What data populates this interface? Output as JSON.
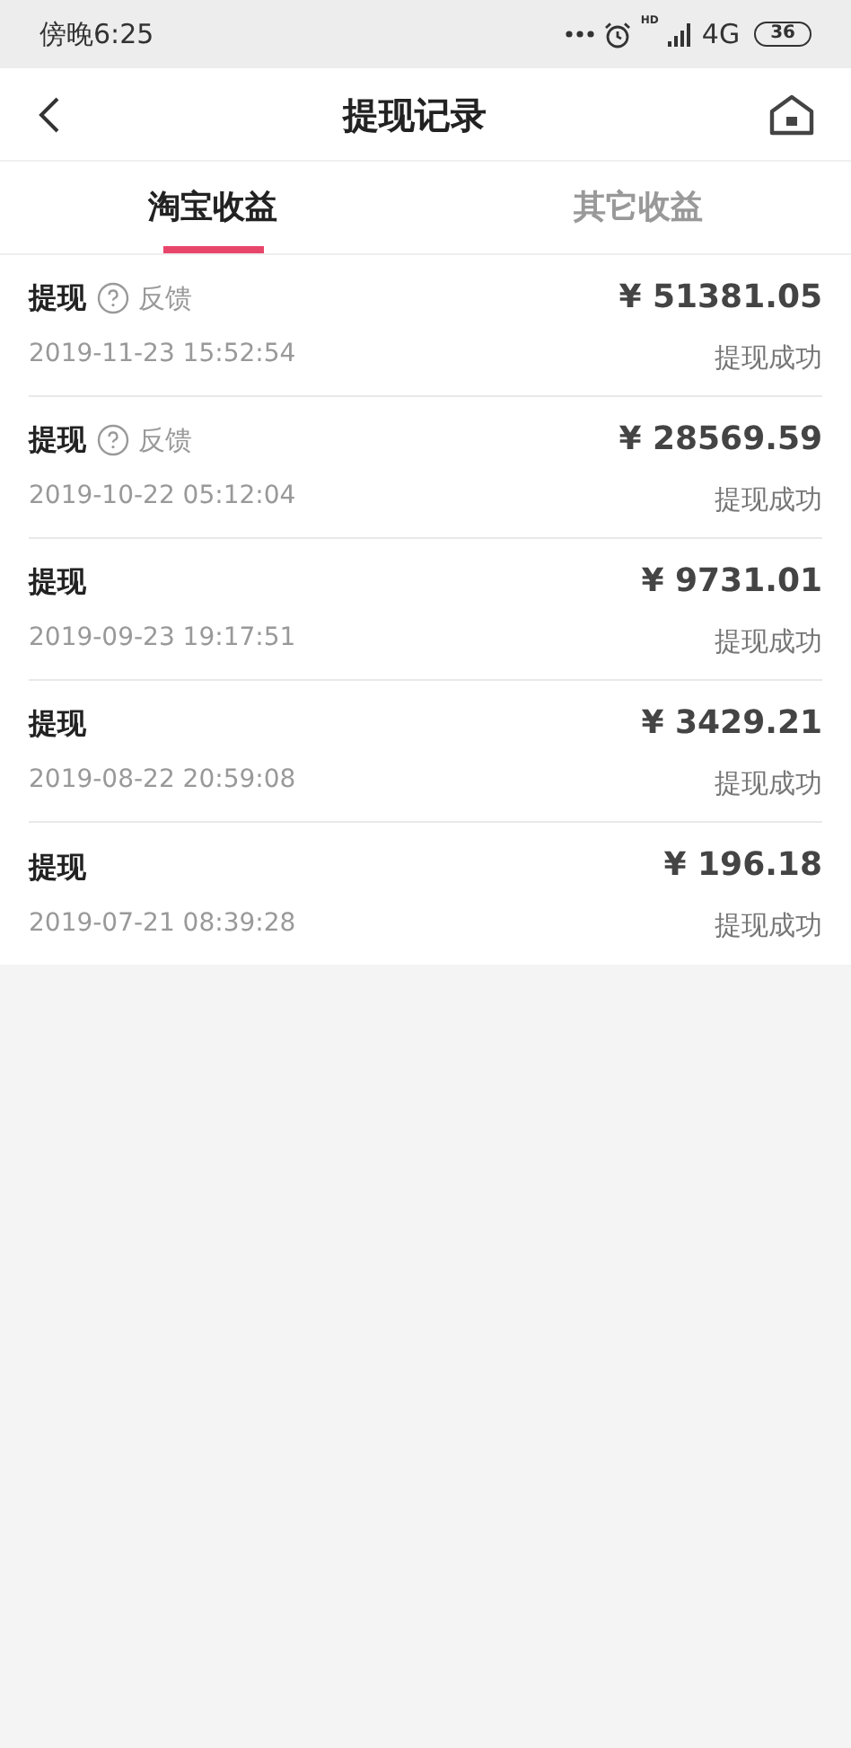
{
  "status_bar": {
    "time": "傍晚6:25",
    "hd": "HD",
    "network": "4G",
    "battery": "36"
  },
  "header": {
    "title": "提现记录"
  },
  "tabs": [
    {
      "label": "淘宝收益",
      "selected": true
    },
    {
      "label": "其它收益",
      "selected": false
    }
  ],
  "records": [
    {
      "title": "提现",
      "feedback": "反馈",
      "date": "2019-11-23 15:52:54",
      "amount": "¥ 51381.05",
      "status": "提现成功"
    },
    {
      "title": "提现",
      "feedback": "反馈",
      "date": "2019-10-22 05:12:04",
      "amount": "¥ 28569.59",
      "status": "提现成功"
    },
    {
      "title": "提现",
      "date": "2019-09-23 19:17:51",
      "amount": "¥ 9731.01",
      "status": "提现成功"
    },
    {
      "title": "提现",
      "date": "2019-08-22 20:59:08",
      "amount": "¥ 3429.21",
      "status": "提现成功"
    },
    {
      "title": "提现",
      "date": "2019-07-21 08:39:28",
      "amount": "¥ 196.18",
      "status": "提现成功"
    }
  ]
}
